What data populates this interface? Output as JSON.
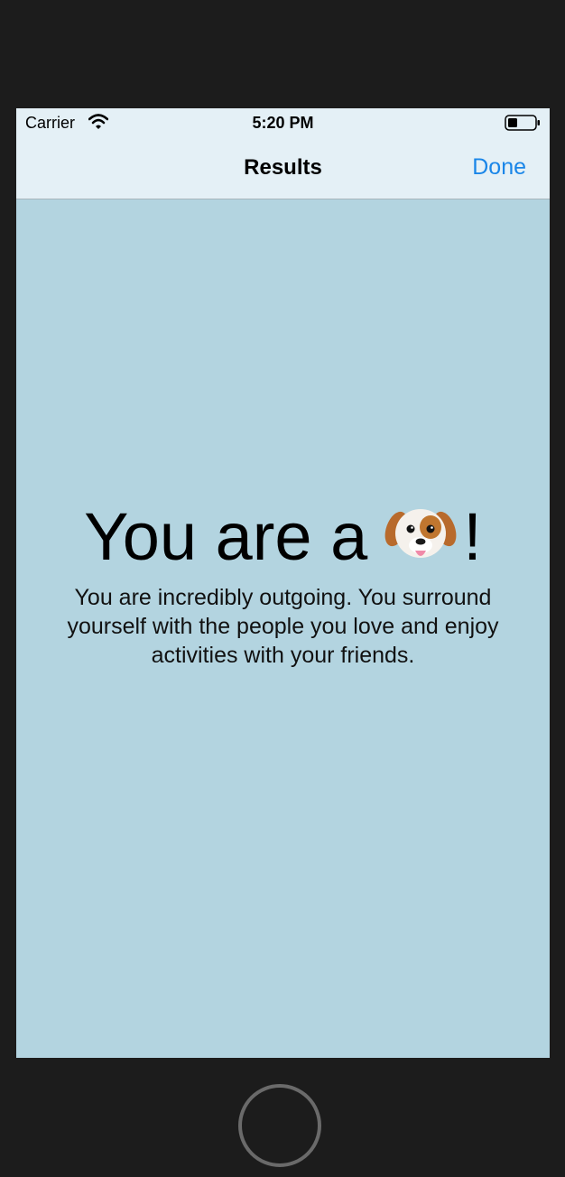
{
  "status_bar": {
    "carrier": "Carrier",
    "time": "5:20 PM"
  },
  "nav_bar": {
    "title": "Results",
    "done_label": "Done"
  },
  "result": {
    "prefix": "You are a",
    "emoji": "dog-face-icon",
    "suffix": "!",
    "description": "You are incredibly outgoing. You surround yourself with the people you love and enjoy activities with your friends."
  },
  "colors": {
    "background": "#b3d4e0",
    "bar_background": "#e4f0f6",
    "accent": "#1a86e8",
    "device_frame": "#1c1c1c"
  }
}
